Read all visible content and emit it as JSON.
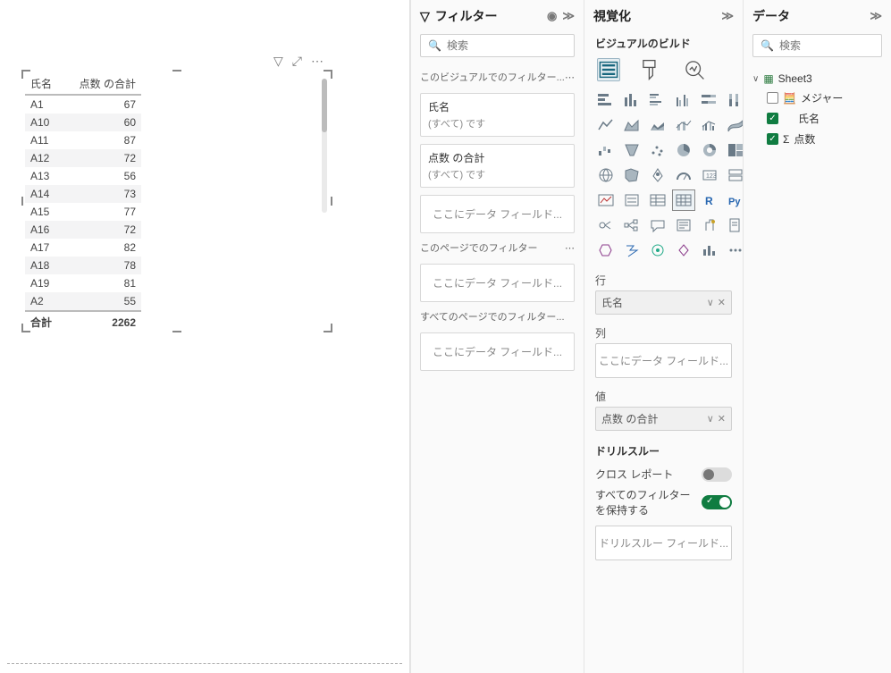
{
  "filters": {
    "title": "フィルター",
    "search_placeholder": "検索",
    "section_visual": "このビジュアルでのフィルター...",
    "card1_title": "氏名",
    "card1_sub": "(すべて) です",
    "card2_title": "点数 の合計",
    "card2_sub": "(すべて) です",
    "dropzone_text": "ここにデータ フィールド...",
    "section_page": "このページでのフィルター",
    "section_all": "すべてのページでのフィルター..."
  },
  "viz": {
    "title": "視覚化",
    "subtitle": "ビジュアルのビルド",
    "rows_label": "行",
    "rows_value": "氏名",
    "cols_label": "列",
    "cols_placeholder": "ここにデータ フィールド...",
    "vals_label": "値",
    "vals_value": "点数 の合計",
    "drill_header": "ドリルスルー",
    "cross_report": "クロス レポート",
    "keep_filters_l1": "すべてのフィルター",
    "keep_filters_l2": "を保持する",
    "drill_field_placeholder": "ドリルスルー フィールド..."
  },
  "data": {
    "title": "データ",
    "search_placeholder": "検索",
    "table_name": "Sheet3",
    "measure_folder": "メジャー",
    "field_name": "氏名",
    "field_score": "点数"
  },
  "table": {
    "col1": "氏名",
    "col2": "点数 の合計",
    "rows": [
      {
        "n": "A1",
        "v": "67"
      },
      {
        "n": "A10",
        "v": "60"
      },
      {
        "n": "A11",
        "v": "87"
      },
      {
        "n": "A12",
        "v": "72"
      },
      {
        "n": "A13",
        "v": "56"
      },
      {
        "n": "A14",
        "v": "73"
      },
      {
        "n": "A15",
        "v": "77"
      },
      {
        "n": "A16",
        "v": "72"
      },
      {
        "n": "A17",
        "v": "82"
      },
      {
        "n": "A18",
        "v": "78"
      },
      {
        "n": "A19",
        "v": "81"
      },
      {
        "n": "A2",
        "v": "55"
      }
    ],
    "total_label": "合計",
    "total_value": "2262"
  },
  "chart_data": {
    "type": "table",
    "title": "",
    "columns": [
      "氏名",
      "点数 の合計"
    ],
    "rows": [
      [
        "A1",
        67
      ],
      [
        "A10",
        60
      ],
      [
        "A11",
        87
      ],
      [
        "A12",
        72
      ],
      [
        "A13",
        56
      ],
      [
        "A14",
        73
      ],
      [
        "A15",
        77
      ],
      [
        "A16",
        72
      ],
      [
        "A17",
        82
      ],
      [
        "A18",
        78
      ],
      [
        "A19",
        81
      ],
      [
        "A2",
        55
      ]
    ],
    "totals": {
      "label": "合計",
      "点数 の合計": 2262
    }
  }
}
